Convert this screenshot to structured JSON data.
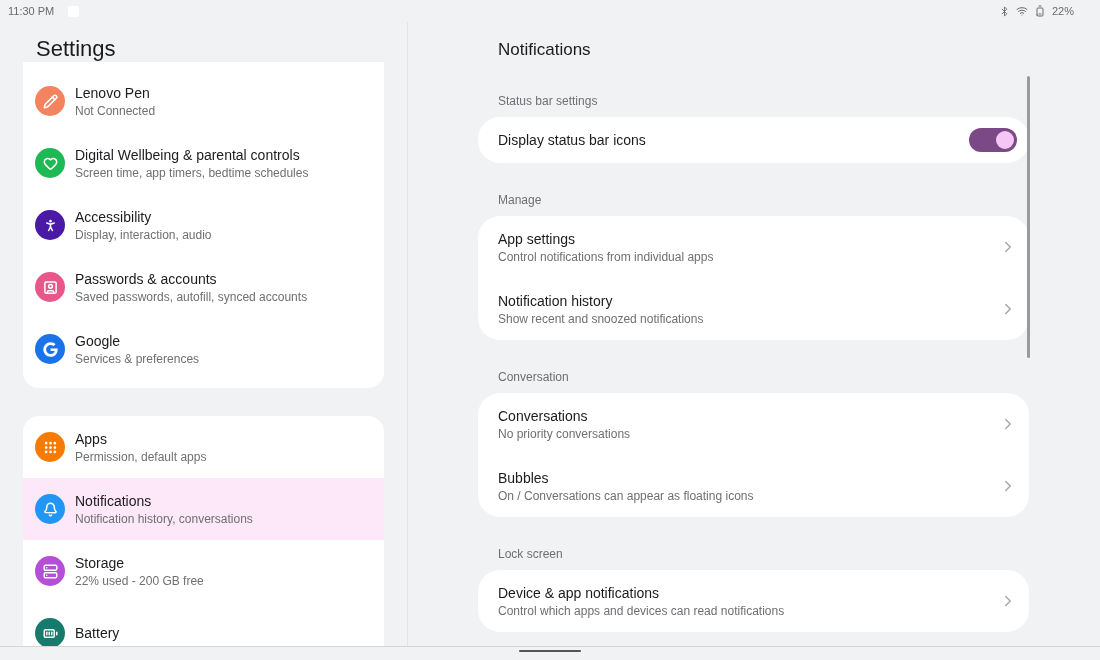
{
  "status_bar": {
    "time": "11:30 PM",
    "battery": "22%"
  },
  "sidebar": {
    "title": "Settings",
    "groups": [
      {
        "items": [
          {
            "title": "Lenovo Pen",
            "subtitle": "Not Connected",
            "color": "#f4845f",
            "selected": false
          },
          {
            "title": "Digital Wellbeing & parental controls",
            "subtitle": "Screen time, app timers, bedtime schedules",
            "color": "#1db954",
            "selected": false
          },
          {
            "title": "Accessibility",
            "subtitle": "Display, interaction, audio",
            "color": "#4a19a6",
            "selected": false
          },
          {
            "title": "Passwords & accounts",
            "subtitle": "Saved passwords, autofill, synced accounts",
            "color": "#e8578a",
            "selected": false
          },
          {
            "title": "Google",
            "subtitle": "Services & preferences",
            "color": "#1a73e8",
            "selected": false
          }
        ]
      },
      {
        "items": [
          {
            "title": "Apps",
            "subtitle": "Permission, default apps",
            "color": "#f57c00",
            "selected": false
          },
          {
            "title": "Notifications",
            "subtitle": "Notification history, conversations",
            "color": "#2196f3",
            "selected": true
          },
          {
            "title": "Storage",
            "subtitle": "22% used - 200 GB free",
            "color": "#b44fd6",
            "selected": false
          },
          {
            "title": "Battery",
            "color": "#177a6c",
            "selected": false
          }
        ]
      }
    ]
  },
  "detail": {
    "title": "Notifications",
    "sections": [
      {
        "header": "Status bar settings",
        "rows": [
          {
            "kind": "toggle",
            "title": "Display status bar icons",
            "on": true
          }
        ]
      },
      {
        "header": "Manage",
        "rows": [
          {
            "kind": "link",
            "title": "App settings",
            "subtitle": "Control notifications from individual apps"
          },
          {
            "kind": "link",
            "title": "Notification history",
            "subtitle": "Show recent and snoozed notifications"
          }
        ]
      },
      {
        "header": "Conversation",
        "rows": [
          {
            "kind": "link",
            "title": "Conversations",
            "subtitle": "No priority conversations"
          },
          {
            "kind": "link",
            "title": "Bubbles",
            "subtitle": "On / Conversations can appear as floating icons"
          }
        ]
      },
      {
        "header": "Lock screen",
        "rows": [
          {
            "kind": "link",
            "title": "Device & app notifications",
            "subtitle": "Control which apps and devices can read notifications"
          }
        ]
      }
    ]
  }
}
